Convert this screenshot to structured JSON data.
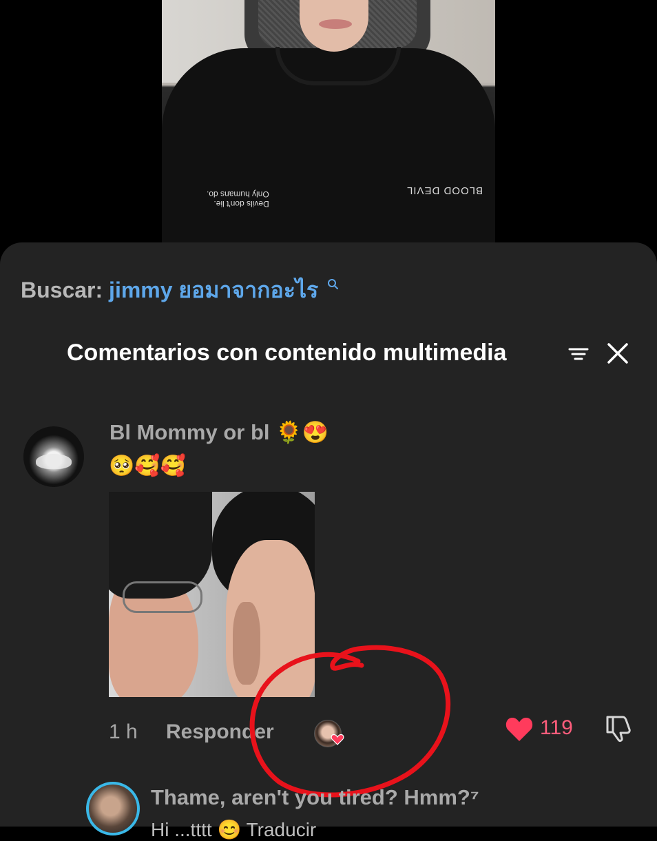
{
  "video": {
    "shirt_print_left": "Devils don't lie.\nOnly humans do.",
    "shirt_print_right": "BLOOD DEVIL"
  },
  "search": {
    "prefix": "Buscar:",
    "term": "jimmy ยอมาจากอะไร",
    "icon": "search-icon"
  },
  "header": {
    "title": "Comentarios con contenido multimedia",
    "filter_icon": "filter-icon",
    "close_icon": "close-icon"
  },
  "comment": {
    "username": "Bl Mommy or bl 🌻😍",
    "text": "🥺🥰🥰",
    "time": "1 h",
    "reply_label": "Responder",
    "like_count": "119",
    "liked_by_creator": true
  },
  "next_comment": {
    "username": "Thame, aren't you tired? Hmm?⁷",
    "partial_line": "Hi ...tttt     😊 Traducir"
  },
  "colors": {
    "sheet_bg": "#232323",
    "search_term": "#5ea7ea",
    "like": "#ff3b5c",
    "annotation": "#e8121b"
  }
}
